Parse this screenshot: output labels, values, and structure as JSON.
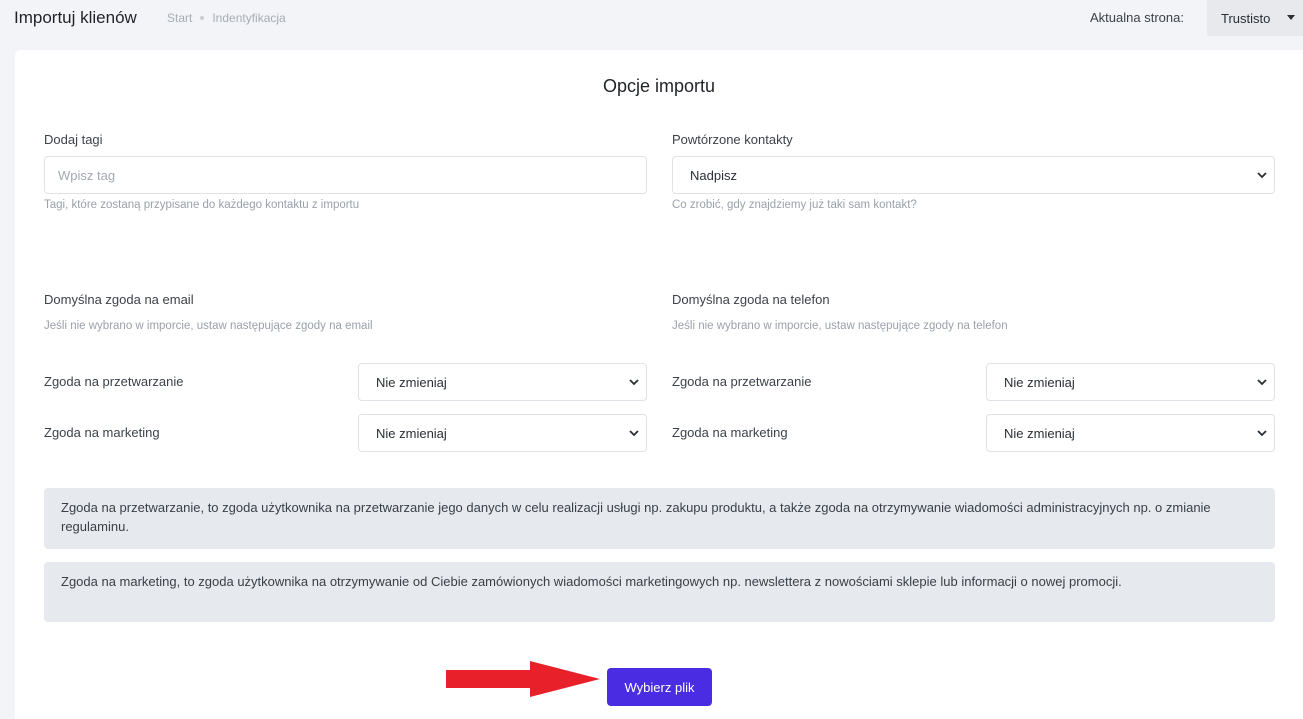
{
  "header": {
    "title": "Importuj klienów",
    "breadcrumb": [
      "Start",
      "Indentyfikacja"
    ],
    "current_store_label": "Aktualna strona:",
    "current_store_value": "Trustisto"
  },
  "main": {
    "section_title": "Opcje importu",
    "tags": {
      "label": "Dodaj tagi",
      "placeholder": "Wpisz tag",
      "help": "Tagi, które zostaną przypisane do każdego kontaktu z importu"
    },
    "duplicates": {
      "label": "Powtórzone kontakty",
      "value": "Nadpisz",
      "help": "Co zrobić, gdy znajdziemy już taki sam kontakt?"
    },
    "email_consent": {
      "title": "Domyślna zgoda na email",
      "help": "Jeśli nie wybrano w imporcie, ustaw następujące zgody na email",
      "processing_label": "Zgoda na przetwarzanie",
      "processing_value": "Nie zmieniaj",
      "marketing_label": "Zgoda na marketing",
      "marketing_value": "Nie zmieniaj"
    },
    "phone_consent": {
      "title": "Domyślna zgoda na telefon",
      "help": "Jeśli nie wybrano w imporcie, ustaw następujące zgody na telefon",
      "processing_label": "Zgoda na przetwarzanie",
      "processing_value": "Nie zmieniaj",
      "marketing_label": "Zgoda na marketing",
      "marketing_value": "Nie zmieniaj"
    },
    "info_processing": "Zgoda na przetwarzanie, to zgoda użytkownika na przetwarzanie jego danych w celu realizacji usługi np. zakupu produktu, a także zgoda na otrzymywanie wiadomości administracyjnych np. o zmianie regulaminu.",
    "info_marketing": "Zgoda na marketing, to zgoda użytkownika na otrzymywanie od Ciebie zamówionych wiadomości marketingowych np. newslettera z nowościami sklepie lub informacji o nowej promocji.",
    "choose_file_button": "Wybierz plik"
  },
  "colors": {
    "primary": "#4a2de3",
    "arrow": "#e8202a"
  }
}
